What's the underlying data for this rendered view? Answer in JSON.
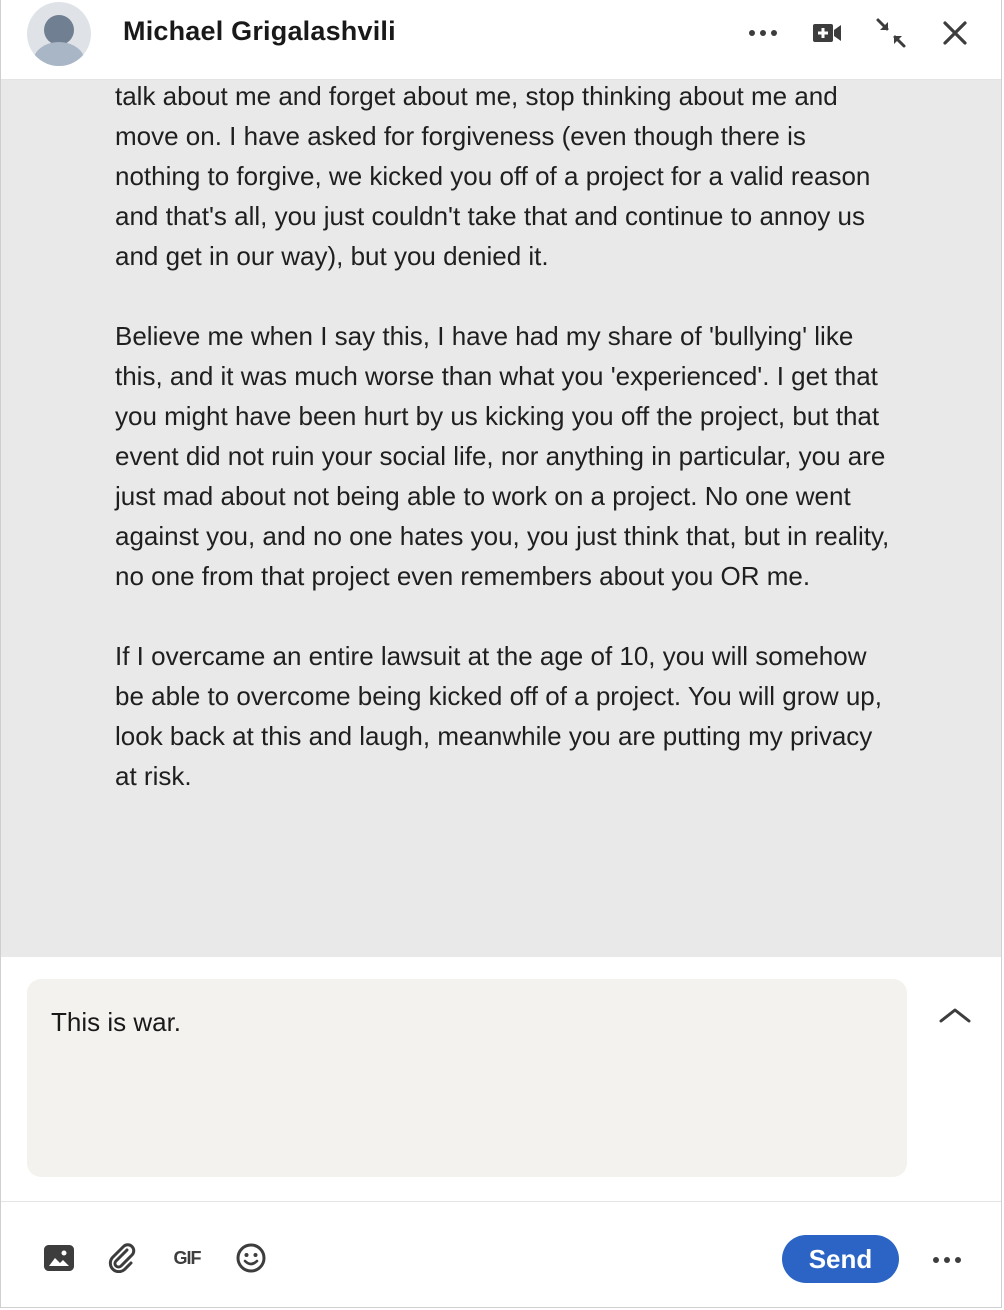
{
  "header": {
    "contact_name": "Michael Grigalashvili"
  },
  "messages": {
    "paragraphs": [
      "talk about me and forget about me, stop thinking about me and move on. I have asked for forgiveness (even though there is nothing to forgive, we kicked you off of a project for a valid reason and that's all, you just couldn't take that and continue to annoy us and get in our way), but you denied it.",
      "Believe me when I say this, I have had my share of 'bullying' like this, and it was much worse than what you 'experienced'. I get that you might have been hurt by us kicking you off the project, but that event did not ruin your social life, nor anything in particular, you are just mad about not being able to work on a project. No one went against you, and no one hates you, you just think that, but in reality, no one from that project even remembers about you OR me.",
      "If I overcame an entire lawsuit at the age of 10, you will somehow be able to overcome being kicked off of a project. You will grow up, look back at this and laugh, meanwhile you are putting my privacy at risk."
    ]
  },
  "composer": {
    "draft_text": "This is war."
  },
  "footer": {
    "gif_label": "GIF",
    "send_label": "Send"
  },
  "colors": {
    "accent": "#2b64c4",
    "message_background": "#e9e9e9",
    "input_background": "#f3f2ef"
  },
  "icons": [
    "more-icon",
    "video-call-icon",
    "minimize-icon",
    "close-icon",
    "chevron-up-icon",
    "image-icon",
    "attachment-icon",
    "gif-icon",
    "emoji-icon",
    "more-options-icon"
  ]
}
